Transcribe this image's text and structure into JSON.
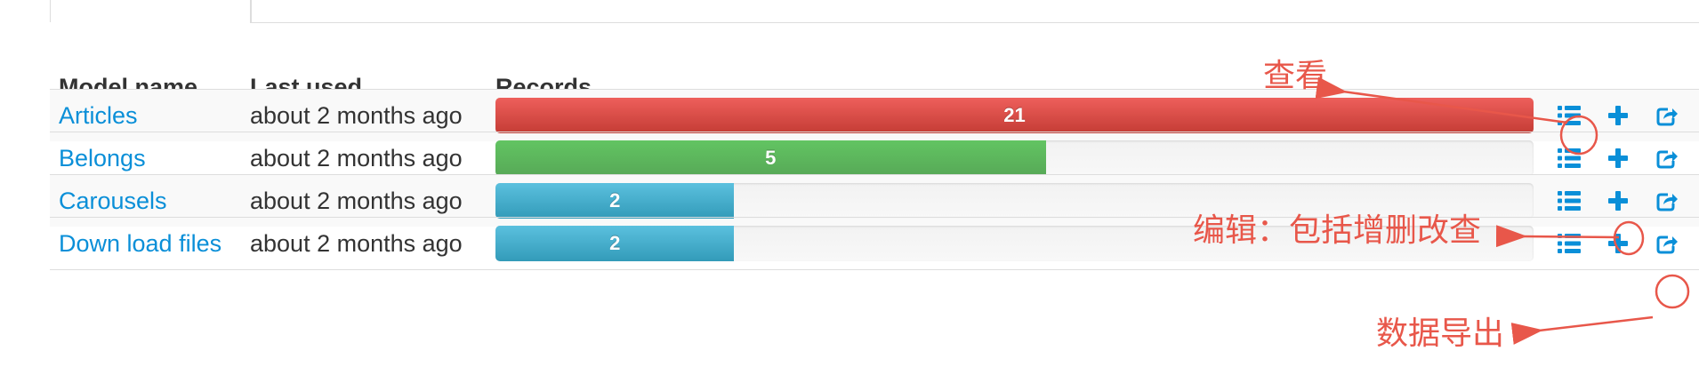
{
  "table": {
    "headers": {
      "model_name": "Model name",
      "last_used": "Last used",
      "records": "Records"
    },
    "rows": [
      {
        "name": "Articles",
        "last_used": "about 2 months ago",
        "records": "21",
        "fraction": 1.0,
        "bar_color": "danger"
      },
      {
        "name": "Belongs",
        "last_used": "about 2 months ago",
        "records": "5",
        "fraction": 0.53,
        "bar_color": "success"
      },
      {
        "name": "Carousels",
        "last_used": "about 2 months ago",
        "records": "2",
        "fraction": 0.23,
        "bar_color": "info"
      },
      {
        "name": "Down load files",
        "last_used": "about 2 months ago",
        "records": "2",
        "fraction": 0.23,
        "bar_color": "info"
      }
    ],
    "actions": {
      "list_icon": "list-icon",
      "add_icon": "plus-icon",
      "export_icon": "share-export-icon",
      "icon_color": "#0a8fd8"
    }
  },
  "annotations": {
    "view": "查看",
    "edit": "编辑：包括增删改查",
    "export": "数据导出",
    "color": "#e8574a"
  }
}
